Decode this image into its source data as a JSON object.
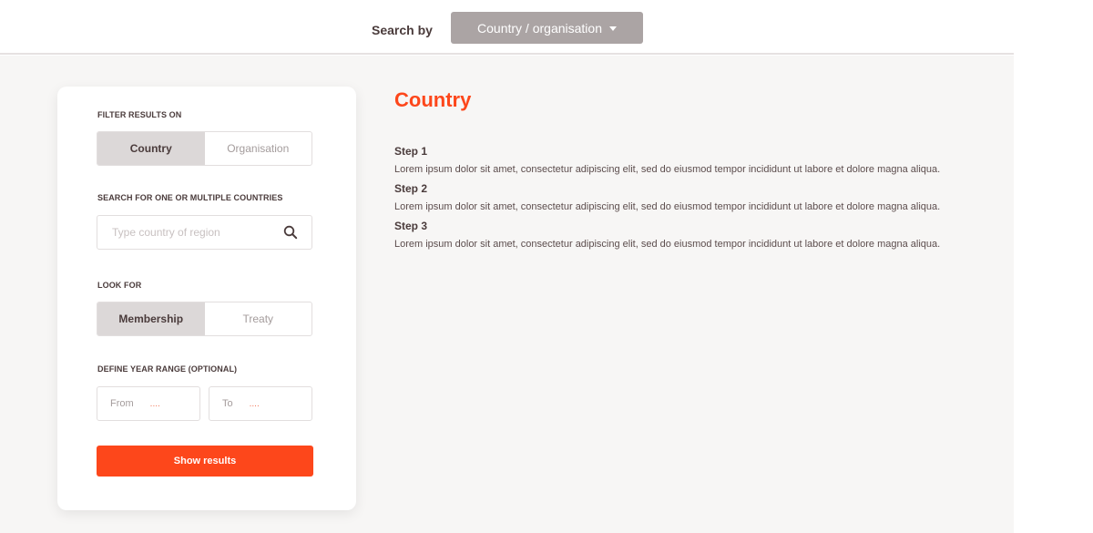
{
  "header": {
    "search_by_label": "Search by",
    "search_by_value": "Country / organisation",
    "search_by_icon": "caret-down-icon"
  },
  "filter_panel": {
    "filter_results_label": "FILTER RESULTS ON",
    "filter_options": [
      {
        "label": "Country",
        "active": true
      },
      {
        "label": "Organisation",
        "active": false
      }
    ],
    "search_label": "SEARCH FOR ONE OR MULTIPLE COUNTRIES",
    "search_placeholder": "Type country of region",
    "search_value": "",
    "search_icon": "search-icon",
    "look_for_label": "LOOK FOR",
    "look_for_options": [
      {
        "label": "Membership",
        "active": true
      },
      {
        "label": "Treaty",
        "active": false
      }
    ],
    "year_range_label": "DEFINE YEAR RANGE (OPTIONAL)",
    "from_label": "From",
    "from_value": "....",
    "to_label": "To",
    "to_value": "....",
    "show_results_label": "Show results"
  },
  "content": {
    "title": "Country",
    "steps": [
      {
        "title": "Step 1",
        "text": "Lorem ipsum dolor sit amet, consectetur adipiscing elit, sed do eiusmod tempor incididunt ut labore et dolore magna aliqua."
      },
      {
        "title": "Step 2",
        "text": "Lorem ipsum dolor sit amet, consectetur adipiscing elit, sed do eiusmod tempor incididunt ut labore et dolore magna aliqua."
      },
      {
        "title": "Step 3",
        "text": "Lorem ipsum dolor sit amet, consectetur adipiscing elit, sed do eiusmod tempor incididunt ut labore et dolore magna aliqua."
      }
    ]
  },
  "colors": {
    "accent": "#fd471b",
    "select_bg": "#aba4a4",
    "active_toggle": "#dcd8d8",
    "page_bg": "#f7f6f5",
    "text_dark": "#4a3b3b"
  }
}
